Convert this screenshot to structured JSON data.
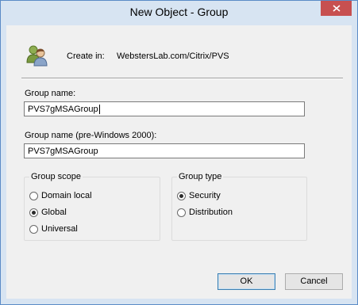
{
  "window": {
    "title": "New Object - Group"
  },
  "header": {
    "create_in_label": "Create in:",
    "create_in_path": "WebstersLab.com/Citrix/PVS",
    "icon": "group-users-icon"
  },
  "fields": {
    "group_name_label": "Group name:",
    "group_name_value": "PVS7gMSAGroup",
    "pre2000_label": "Group name (pre-Windows 2000):",
    "pre2000_value": "PVS7gMSAGroup"
  },
  "group_scope": {
    "title": "Group scope",
    "options": [
      {
        "label": "Domain local",
        "checked": false
      },
      {
        "label": "Global",
        "checked": true
      },
      {
        "label": "Universal",
        "checked": false
      }
    ]
  },
  "group_type": {
    "title": "Group type",
    "options": [
      {
        "label": "Security",
        "checked": true
      },
      {
        "label": "Distribution",
        "checked": false
      }
    ]
  },
  "buttons": {
    "ok": "OK",
    "cancel": "Cancel"
  },
  "colors": {
    "title_bar": "#d7e4f2",
    "close_button": "#c75050",
    "client": "#f0f0f0"
  }
}
